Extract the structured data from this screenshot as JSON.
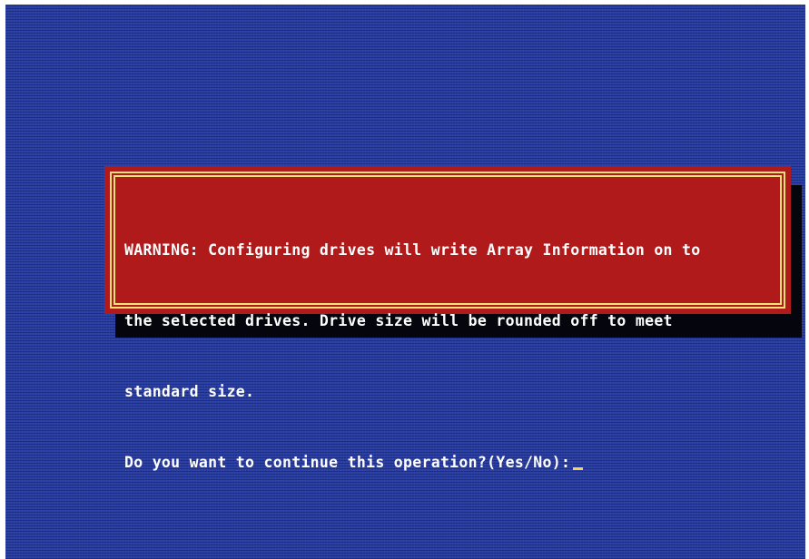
{
  "screen": {
    "background_color": "#2a3fa0"
  },
  "dialog": {
    "background_color": "#b01a1a",
    "border_color": "#f2e27a",
    "lines": [
      "WARNING: Configuring drives will write Array Information on to",
      "the selected drives. Drive size will be rounded off to meet",
      "standard size.",
      "Do you want to continue this operation?(Yes/No):"
    ],
    "cursor_color": "#f6d34a"
  }
}
